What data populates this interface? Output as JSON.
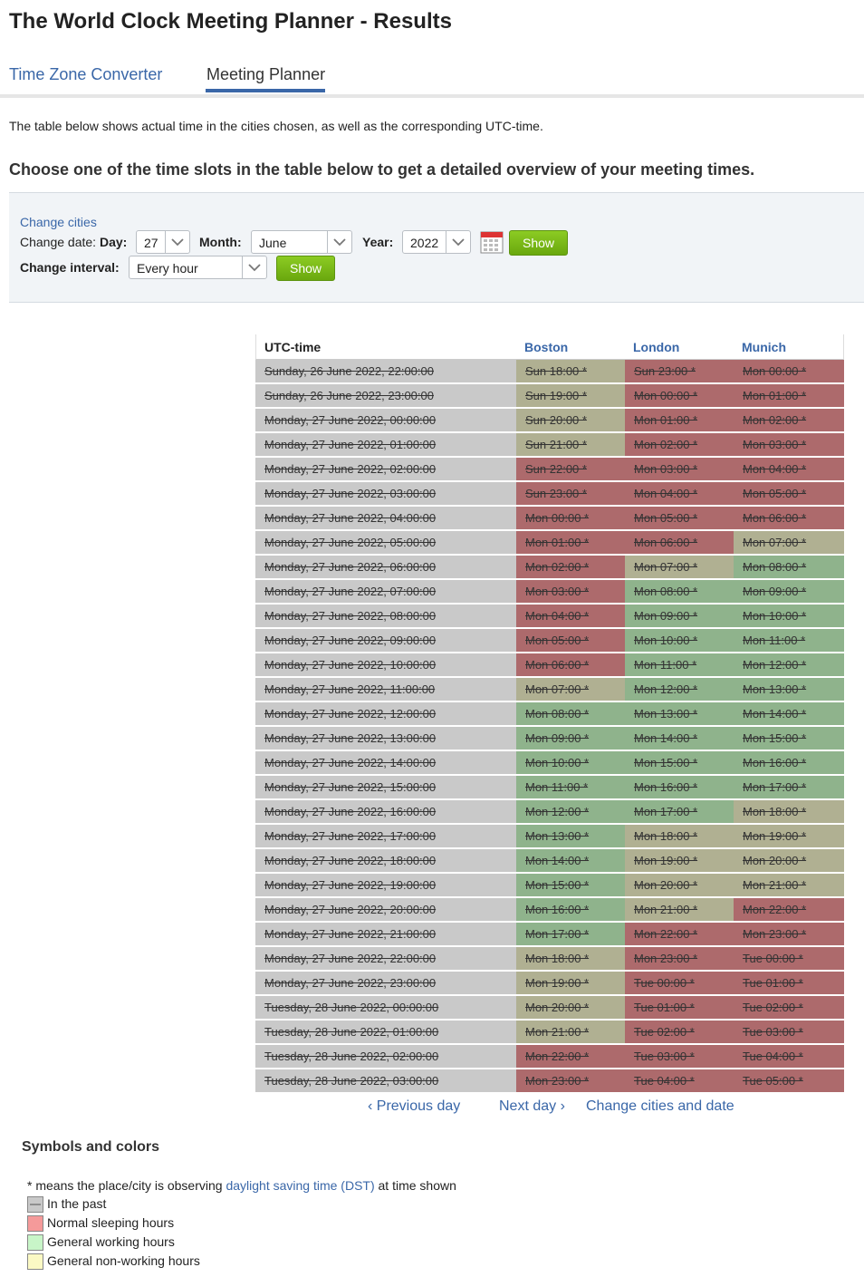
{
  "page": {
    "title": "The World Clock Meeting Planner - Results"
  },
  "tabs": [
    {
      "label": "Time Zone Converter"
    },
    {
      "label": "Meeting Planner"
    }
  ],
  "intro": "The table below shows actual time in the cities chosen, as well as the corresponding UTC-time.",
  "choose": "Choose one of the time slots in the table below to get a detailed overview of your meeting times.",
  "form": {
    "change_cities": "Change cities",
    "change_date": "Change date:",
    "day_label": "Day:",
    "day_value": "27",
    "month_label": "Month:",
    "month_value": "June",
    "year_label": "Year:",
    "year_value": "2022",
    "interval_label": "Change interval:",
    "interval_value": "Every hour",
    "show_label": "Show"
  },
  "colors": {
    "past": "#c9c9c9",
    "sleep": "#ad6a6c",
    "work": "#8fb38c",
    "nonwork": "#b0b092",
    "link": "#3a67a8",
    "button": "#7ab51a"
  },
  "table": {
    "headers": [
      "UTC-time",
      "Boston",
      "London",
      "Munich"
    ],
    "rows": [
      {
        "utc": "Sunday, 26 June 2022, 22:00:00",
        "boston": "Sun 18:00 *",
        "london": "Sun 23:00 *",
        "munich": "Mon 00:00 *",
        "bc": "nonwork",
        "lc": "sleep",
        "mc": "sleep"
      },
      {
        "utc": "Sunday, 26 June 2022, 23:00:00",
        "boston": "Sun 19:00 *",
        "london": "Mon 00:00 *",
        "munich": "Mon 01:00 *",
        "bc": "nonwork",
        "lc": "sleep",
        "mc": "sleep"
      },
      {
        "utc": "Monday, 27 June 2022, 00:00:00",
        "boston": "Sun 20:00 *",
        "london": "Mon 01:00 *",
        "munich": "Mon 02:00 *",
        "bc": "nonwork",
        "lc": "sleep",
        "mc": "sleep"
      },
      {
        "utc": "Monday, 27 June 2022, 01:00:00",
        "boston": "Sun 21:00 *",
        "london": "Mon 02:00 *",
        "munich": "Mon 03:00 *",
        "bc": "nonwork",
        "lc": "sleep",
        "mc": "sleep"
      },
      {
        "utc": "Monday, 27 June 2022, 02:00:00",
        "boston": "Sun 22:00 *",
        "london": "Mon 03:00 *",
        "munich": "Mon 04:00 *",
        "bc": "sleep",
        "lc": "sleep",
        "mc": "sleep"
      },
      {
        "utc": "Monday, 27 June 2022, 03:00:00",
        "boston": "Sun 23:00 *",
        "london": "Mon 04:00 *",
        "munich": "Mon 05:00 *",
        "bc": "sleep",
        "lc": "sleep",
        "mc": "sleep"
      },
      {
        "utc": "Monday, 27 June 2022, 04:00:00",
        "boston": "Mon 00:00 *",
        "london": "Mon 05:00 *",
        "munich": "Mon 06:00 *",
        "bc": "sleep",
        "lc": "sleep",
        "mc": "sleep"
      },
      {
        "utc": "Monday, 27 June 2022, 05:00:00",
        "boston": "Mon 01:00 *",
        "london": "Mon 06:00 *",
        "munich": "Mon 07:00 *",
        "bc": "sleep",
        "lc": "sleep",
        "mc": "nonwork"
      },
      {
        "utc": "Monday, 27 June 2022, 06:00:00",
        "boston": "Mon 02:00 *",
        "london": "Mon 07:00 *",
        "munich": "Mon 08:00 *",
        "bc": "sleep",
        "lc": "nonwork",
        "mc": "work"
      },
      {
        "utc": "Monday, 27 June 2022, 07:00:00",
        "boston": "Mon 03:00 *",
        "london": "Mon 08:00 *",
        "munich": "Mon 09:00 *",
        "bc": "sleep",
        "lc": "work",
        "mc": "work"
      },
      {
        "utc": "Monday, 27 June 2022, 08:00:00",
        "boston": "Mon 04:00 *",
        "london": "Mon 09:00 *",
        "munich": "Mon 10:00 *",
        "bc": "sleep",
        "lc": "work",
        "mc": "work"
      },
      {
        "utc": "Monday, 27 June 2022, 09:00:00",
        "boston": "Mon 05:00 *",
        "london": "Mon 10:00 *",
        "munich": "Mon 11:00 *",
        "bc": "sleep",
        "lc": "work",
        "mc": "work"
      },
      {
        "utc": "Monday, 27 June 2022, 10:00:00",
        "boston": "Mon 06:00 *",
        "london": "Mon 11:00 *",
        "munich": "Mon 12:00 *",
        "bc": "sleep",
        "lc": "work",
        "mc": "work"
      },
      {
        "utc": "Monday, 27 June 2022, 11:00:00",
        "boston": "Mon 07:00 *",
        "london": "Mon 12:00 *",
        "munich": "Mon 13:00 *",
        "bc": "nonwork",
        "lc": "work",
        "mc": "work"
      },
      {
        "utc": "Monday, 27 June 2022, 12:00:00",
        "boston": "Mon 08:00 *",
        "london": "Mon 13:00 *",
        "munich": "Mon 14:00 *",
        "bc": "work",
        "lc": "work",
        "mc": "work"
      },
      {
        "utc": "Monday, 27 June 2022, 13:00:00",
        "boston": "Mon 09:00 *",
        "london": "Mon 14:00 *",
        "munich": "Mon 15:00 *",
        "bc": "work",
        "lc": "work",
        "mc": "work"
      },
      {
        "utc": "Monday, 27 June 2022, 14:00:00",
        "boston": "Mon 10:00 *",
        "london": "Mon 15:00 *",
        "munich": "Mon 16:00 *",
        "bc": "work",
        "lc": "work",
        "mc": "work"
      },
      {
        "utc": "Monday, 27 June 2022, 15:00:00",
        "boston": "Mon 11:00 *",
        "london": "Mon 16:00 *",
        "munich": "Mon 17:00 *",
        "bc": "work",
        "lc": "work",
        "mc": "work"
      },
      {
        "utc": "Monday, 27 June 2022, 16:00:00",
        "boston": "Mon 12:00 *",
        "london": "Mon 17:00 *",
        "munich": "Mon 18:00 *",
        "bc": "work",
        "lc": "work",
        "mc": "nonwork"
      },
      {
        "utc": "Monday, 27 June 2022, 17:00:00",
        "boston": "Mon 13:00 *",
        "london": "Mon 18:00 *",
        "munich": "Mon 19:00 *",
        "bc": "work",
        "lc": "nonwork",
        "mc": "nonwork"
      },
      {
        "utc": "Monday, 27 June 2022, 18:00:00",
        "boston": "Mon 14:00 *",
        "london": "Mon 19:00 *",
        "munich": "Mon 20:00 *",
        "bc": "work",
        "lc": "nonwork",
        "mc": "nonwork"
      },
      {
        "utc": "Monday, 27 June 2022, 19:00:00",
        "boston": "Mon 15:00 *",
        "london": "Mon 20:00 *",
        "munich": "Mon 21:00 *",
        "bc": "work",
        "lc": "nonwork",
        "mc": "nonwork"
      },
      {
        "utc": "Monday, 27 June 2022, 20:00:00",
        "boston": "Mon 16:00 *",
        "london": "Mon 21:00 *",
        "munich": "Mon 22:00 *",
        "bc": "work",
        "lc": "nonwork",
        "mc": "sleep"
      },
      {
        "utc": "Monday, 27 June 2022, 21:00:00",
        "boston": "Mon 17:00 *",
        "london": "Mon 22:00 *",
        "munich": "Mon 23:00 *",
        "bc": "work",
        "lc": "sleep",
        "mc": "sleep"
      },
      {
        "utc": "Monday, 27 June 2022, 22:00:00",
        "boston": "Mon 18:00 *",
        "london": "Mon 23:00 *",
        "munich": "Tue 00:00 *",
        "bc": "nonwork",
        "lc": "sleep",
        "mc": "sleep"
      },
      {
        "utc": "Monday, 27 June 2022, 23:00:00",
        "boston": "Mon 19:00 *",
        "london": "Tue 00:00 *",
        "munich": "Tue 01:00 *",
        "bc": "nonwork",
        "lc": "sleep",
        "mc": "sleep"
      },
      {
        "utc": "Tuesday, 28 June 2022, 00:00:00",
        "boston": "Mon 20:00 *",
        "london": "Tue 01:00 *",
        "munich": "Tue 02:00 *",
        "bc": "nonwork",
        "lc": "sleep",
        "mc": "sleep"
      },
      {
        "utc": "Tuesday, 28 June 2022, 01:00:00",
        "boston": "Mon 21:00 *",
        "london": "Tue 02:00 *",
        "munich": "Tue 03:00 *",
        "bc": "nonwork",
        "lc": "sleep",
        "mc": "sleep"
      },
      {
        "utc": "Tuesday, 28 June 2022, 02:00:00",
        "boston": "Mon 22:00 *",
        "london": "Tue 03:00 *",
        "munich": "Tue 04:00 *",
        "bc": "sleep",
        "lc": "sleep",
        "mc": "sleep"
      },
      {
        "utc": "Tuesday, 28 June 2022, 03:00:00",
        "boston": "Mon 23:00 *",
        "london": "Tue 04:00 *",
        "munich": "Tue 05:00 *",
        "bc": "sleep",
        "lc": "sleep",
        "mc": "sleep"
      }
    ]
  },
  "nav": {
    "prev": "Previous day",
    "next": "Next day",
    "change": "Change cities and date"
  },
  "legend": {
    "title": "Symbols and colors",
    "note_prefix": "* means the place/city is observing",
    "note_link": "daylight saving time (DST)",
    "note_suffix": "at time shown",
    "items": [
      {
        "label": "In the past",
        "color": "#c9c9c9"
      },
      {
        "label": "Normal sleeping hours",
        "color": "#f59a9a"
      },
      {
        "label": "General working hours",
        "color": "#c8f5c8"
      },
      {
        "label": "General non-working hours",
        "color": "#fbf9c4"
      }
    ]
  }
}
